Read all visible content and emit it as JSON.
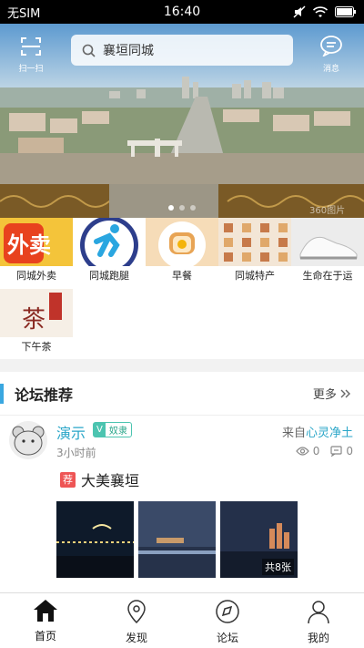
{
  "status_bar": {
    "carrier": "无SIM",
    "time": "16:40"
  },
  "header": {
    "scan_label": "扫一扫",
    "search_text": "襄垣同城",
    "message_label": "消息",
    "watermark": "360图片"
  },
  "categories": [
    {
      "label": "同城外卖",
      "icon": "takeout-image"
    },
    {
      "label": "同城跑腿",
      "icon": "runner-image"
    },
    {
      "label": "早餐",
      "icon": "breakfast-image"
    },
    {
      "label": "同城特产",
      "icon": "specialty-image"
    },
    {
      "label": "生命在于运",
      "icon": "sneaker-image"
    },
    {
      "label": "下午茶",
      "icon": "tea-image",
      "image_text": "茶"
    }
  ],
  "forum": {
    "title": "论坛推荐",
    "more": "更多",
    "post": {
      "author": "演示",
      "vip_badge": "V",
      "level": "奴隶",
      "from_prefix": "来自",
      "from_source": "心灵净土",
      "time_ago": "3小时前",
      "views": "0",
      "comments": "0",
      "tag": "荐",
      "title": "大美襄垣",
      "image_count": "共8张"
    }
  },
  "bottom_nav": [
    {
      "label": "首页",
      "icon": "home-icon",
      "active": true
    },
    {
      "label": "发现",
      "icon": "location-pin-icon",
      "active": false
    },
    {
      "label": "论坛",
      "icon": "compass-icon",
      "active": false
    },
    {
      "label": "我的",
      "icon": "person-icon",
      "active": false
    }
  ]
}
